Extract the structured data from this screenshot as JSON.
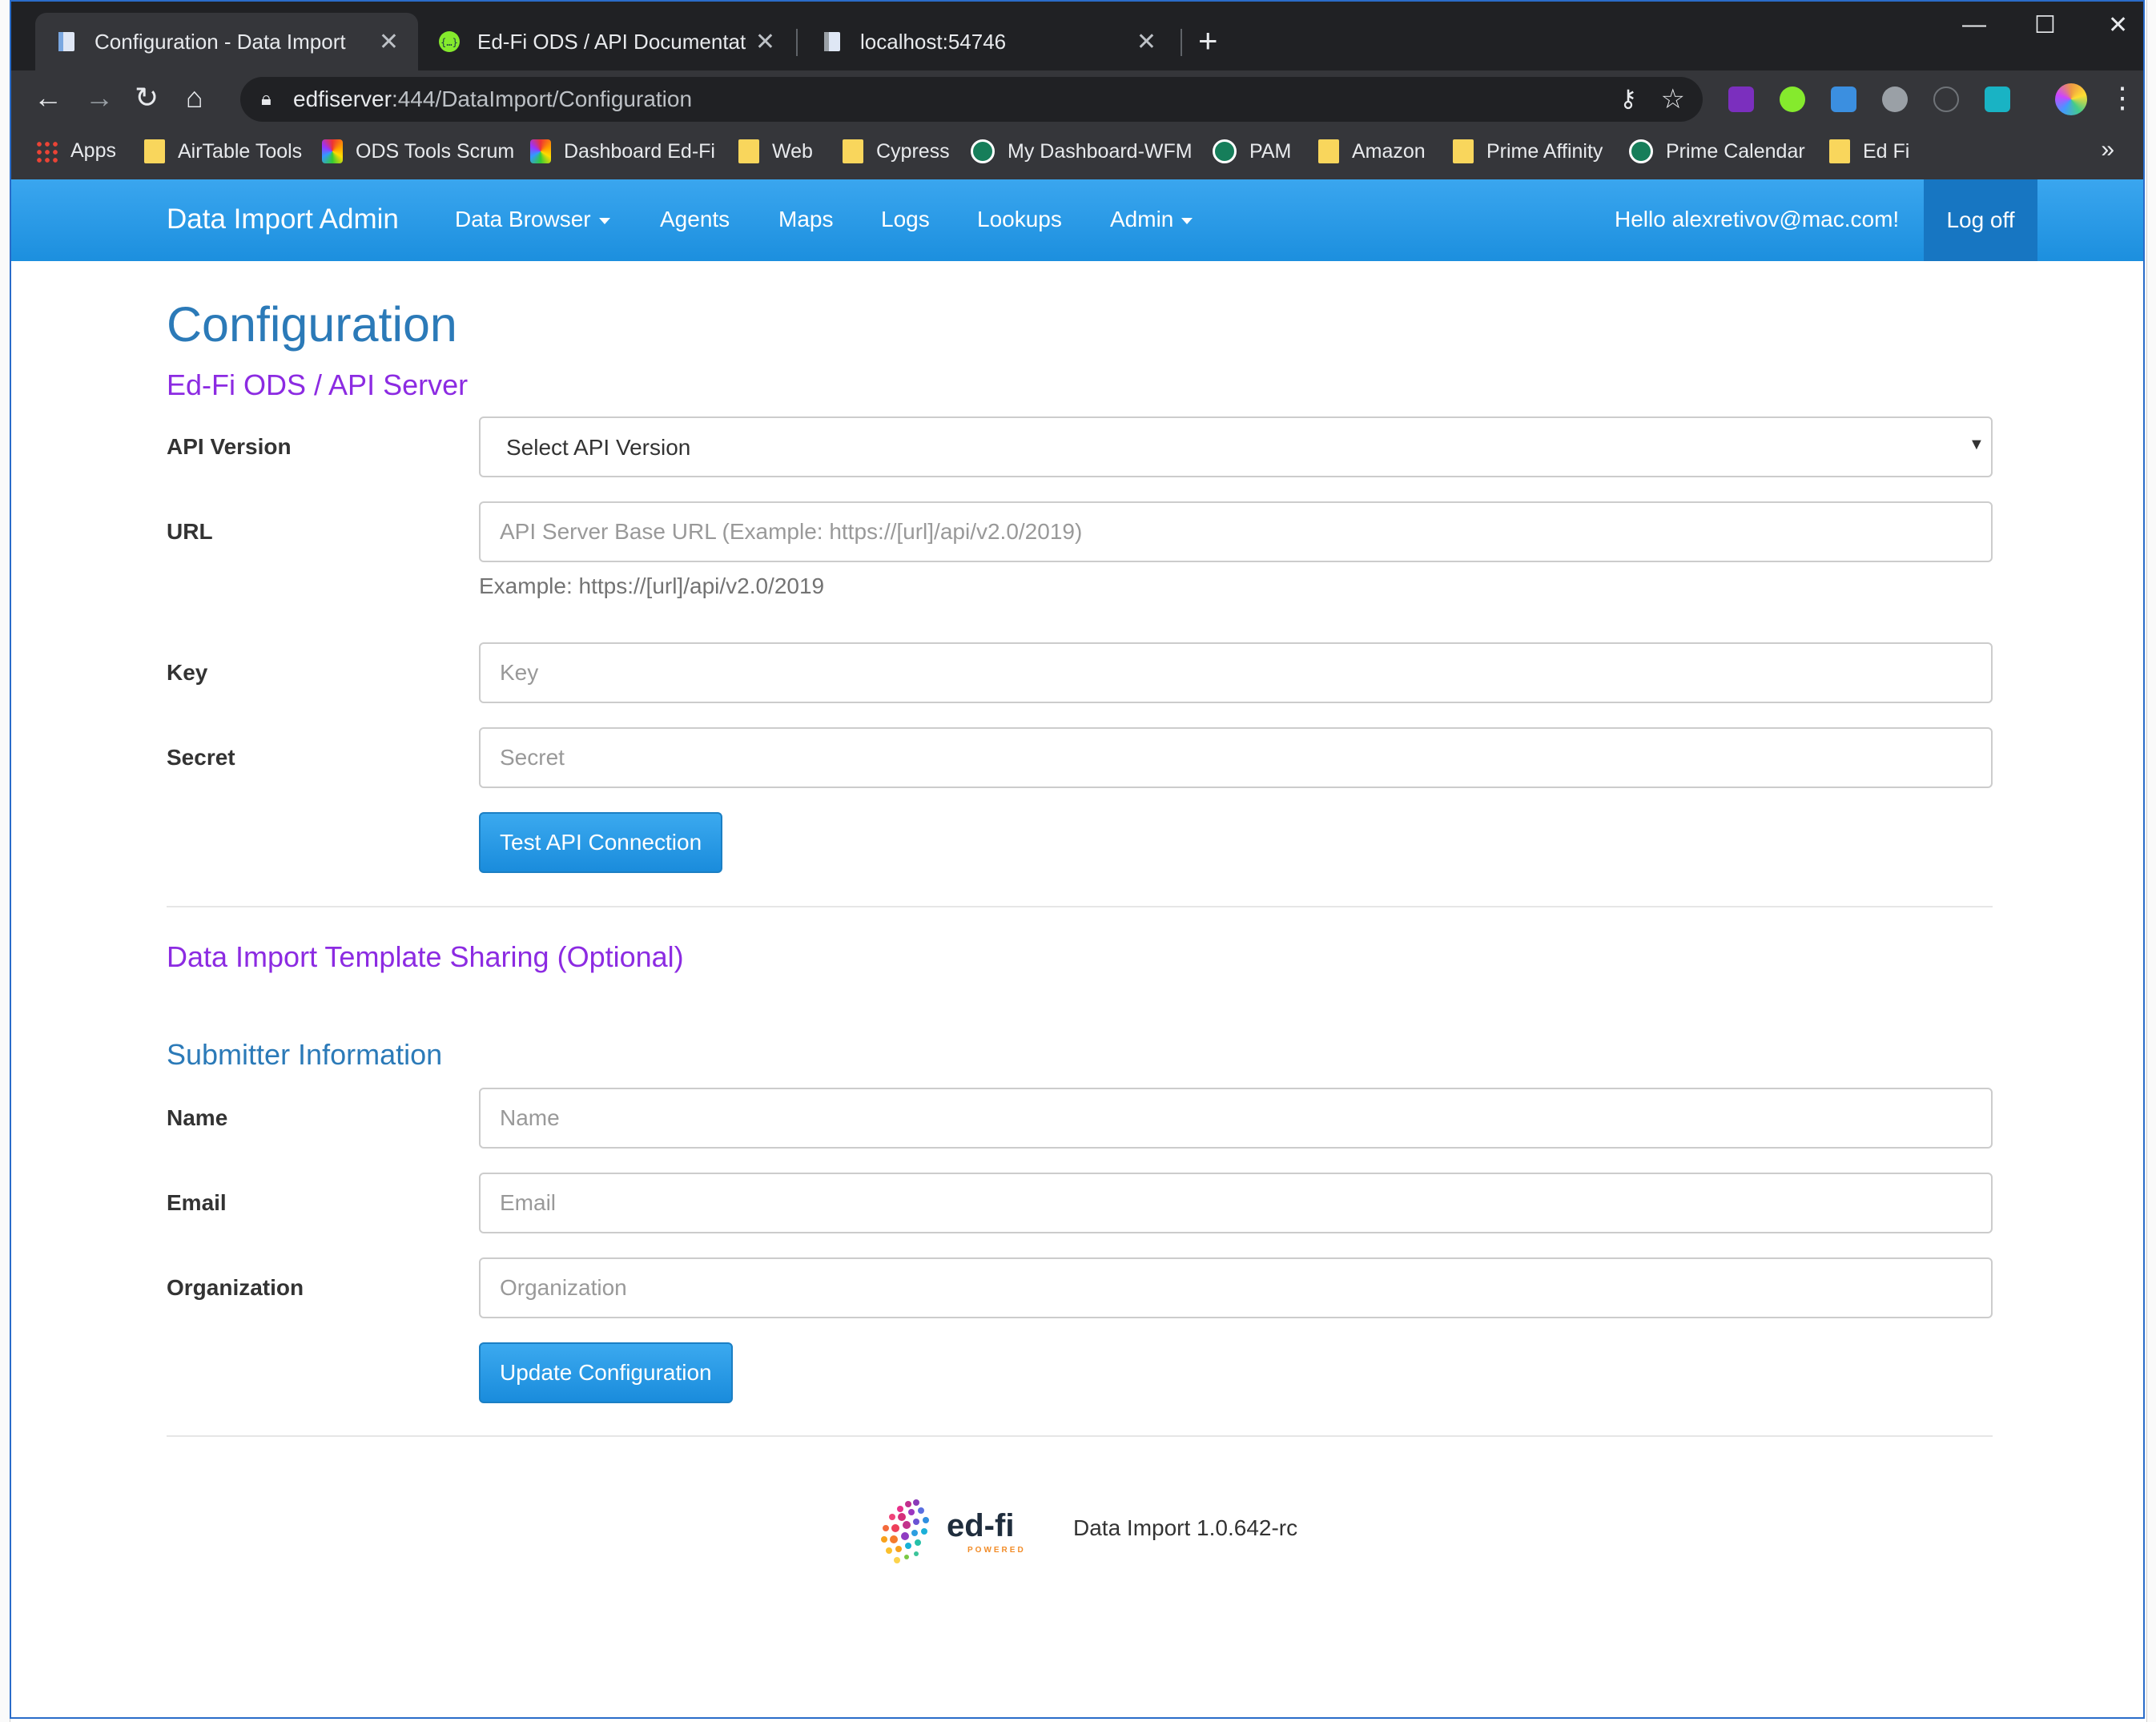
{
  "browser": {
    "tabs": [
      {
        "title": "Configuration - Data Import",
        "icon": "page-icon"
      },
      {
        "title": "Ed-Fi ODS / API Documentation",
        "icon": "swagger-icon"
      },
      {
        "title": "localhost:54746",
        "icon": "page-icon"
      }
    ],
    "new_tab": "+",
    "url_host": "edfiserver",
    "url_path": ":444/DataImport/Configuration",
    "bookmarks": [
      {
        "label": "Apps",
        "icon": "apps-grid-icon"
      },
      {
        "label": "AirTable Tools",
        "icon": "folder-icon"
      },
      {
        "label": "ODS Tools Scrum",
        "icon": "edfi-spark-icon"
      },
      {
        "label": "Dashboard Ed-Fi",
        "icon": "edfi-spark-icon"
      },
      {
        "label": "Web",
        "icon": "folder-icon"
      },
      {
        "label": "Cypress",
        "icon": "folder-icon"
      },
      {
        "label": "My Dashboard-WFM",
        "icon": "green-site-icon"
      },
      {
        "label": "PAM",
        "icon": "green-site-icon"
      },
      {
        "label": "Amazon",
        "icon": "folder-icon"
      },
      {
        "label": "Prime Affinity",
        "icon": "folder-icon"
      },
      {
        "label": "Prime Calendar",
        "icon": "green-site-icon"
      },
      {
        "label": "Ed Fi",
        "icon": "folder-icon"
      }
    ],
    "bookmarks_more": "»"
  },
  "nav": {
    "brand": "Data Import Admin",
    "links": [
      "Data Browser",
      "Agents",
      "Maps",
      "Logs",
      "Lookups",
      "Admin"
    ],
    "hello": "Hello alexretivov@mac.com!",
    "logoff": "Log off"
  },
  "page": {
    "title": "Configuration",
    "api_section": "Ed-Fi ODS / API Server",
    "api_version_label": "API Version",
    "api_version_value": "Select API Version",
    "url_label": "URL",
    "url_placeholder": "API Server Base URL (Example: https://[url]/api/v2.0/2019)",
    "url_help": "Example: https://[url]/api/v2.0/2019",
    "key_label": "Key",
    "key_placeholder": "Key",
    "secret_label": "Secret",
    "secret_placeholder": "Secret",
    "test_button": "Test API Connection",
    "sharing_section": "Data Import Template Sharing (Optional)",
    "submitter_section": "Submitter Information",
    "name_label": "Name",
    "name_placeholder": "Name",
    "email_label": "Email",
    "email_placeholder": "Email",
    "org_label": "Organization",
    "org_placeholder": "Organization",
    "update_button": "Update Configuration"
  },
  "footer": {
    "logo_text": "ed-fi",
    "logo_sub": "POWERED",
    "version": "Data Import 1.0.642-rc"
  },
  "colors": {
    "navbar": "#2a9be6",
    "heading_blue": "#2b7ab8",
    "heading_purple": "#8c2be2",
    "button": "#2a9be6"
  }
}
